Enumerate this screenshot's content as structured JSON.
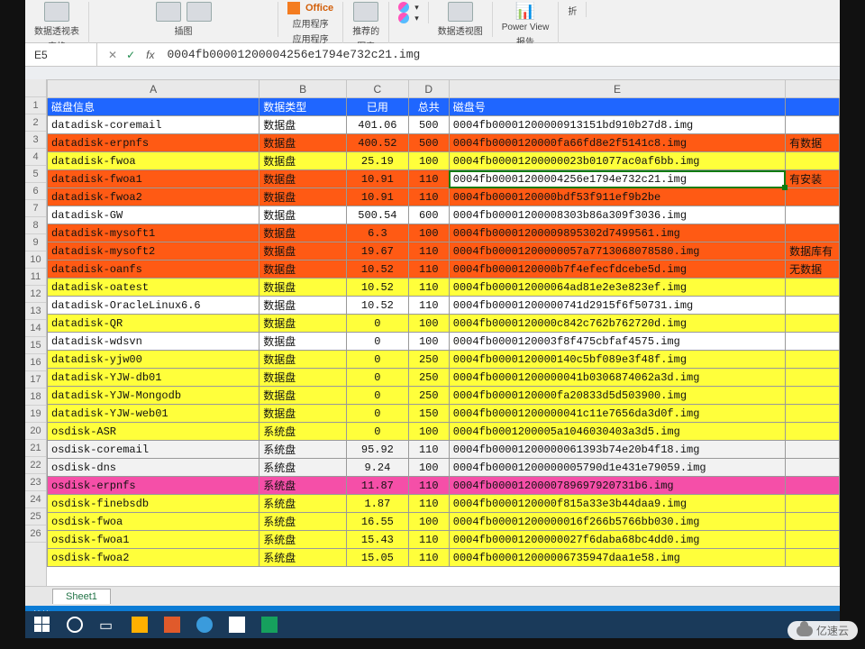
{
  "ribbon": {
    "groups": {
      "pivot": "数据透视表",
      "tables": "表格",
      "illus": "插图",
      "office_top": "Office",
      "apps1": "应用程序",
      "apps2": "应用程序",
      "reco": "推荐的",
      "charts": "图表",
      "pivotchart": "数据透视图",
      "powerview": "Power View",
      "reports": "报告",
      "fold": "折"
    }
  },
  "namebox": "E5",
  "formula": "0004fb00001200004256e1794e732c21.img",
  "columns": [
    "A",
    "B",
    "C",
    "D",
    "E"
  ],
  "header": {
    "A": "磁盘信息",
    "B": "数据类型",
    "C": "已用",
    "D": "总共",
    "E": "磁盘号"
  },
  "rows": [
    {
      "n": 2,
      "cls": "rw",
      "A": "datadisk-coremail",
      "B": "数据盘",
      "C": "401.06",
      "D": "500",
      "E": "0004fb00001200000913151bd910b27d8.img",
      "F": ""
    },
    {
      "n": 3,
      "cls": "ro",
      "A": "datadisk-erpnfs",
      "B": "数据盘",
      "C": "400.52",
      "D": "500",
      "E": "0004fb0000120000fa66fd8e2f5141c8.img",
      "F": "有数据"
    },
    {
      "n": 4,
      "cls": "ry",
      "A": "datadisk-fwoa",
      "B": "数据盘",
      "C": "25.19",
      "D": "100",
      "E": "0004fb00001200000023b01077ac0af6bb.img",
      "F": ""
    },
    {
      "n": 5,
      "cls": "ro",
      "A": "datadisk-fwoa1",
      "B": "数据盘",
      "C": "10.91",
      "D": "110",
      "E": "0004fb00001200004256e1794e732c21.img",
      "F": "有安装",
      "sel": true
    },
    {
      "n": 6,
      "cls": "ro",
      "A": "datadisk-fwoa2",
      "B": "数据盘",
      "C": "10.91",
      "D": "110",
      "E": "0004fb0000120000bdf53f911ef9b2be",
      "F": ""
    },
    {
      "n": 7,
      "cls": "rw",
      "A": "datadisk-GW",
      "B": "数据盘",
      "C": "500.54",
      "D": "600",
      "E": "0004fb00001200008303b86a309f3036.img",
      "F": ""
    },
    {
      "n": 8,
      "cls": "ro",
      "A": "datadisk-mysoft1",
      "B": "数据盘",
      "C": "6.3",
      "D": "100",
      "E": "0004fb00001200009895302d7499561.img",
      "F": ""
    },
    {
      "n": 9,
      "cls": "ro",
      "A": "datadisk-mysoft2",
      "B": "数据盘",
      "C": "19.67",
      "D": "110",
      "E": "0004fb00001200000057a7713068078580.img",
      "F": "数据库有"
    },
    {
      "n": 10,
      "cls": "ro",
      "A": "datadisk-oanfs",
      "B": "数据盘",
      "C": "10.52",
      "D": "110",
      "E": "0004fb0000120000b7f4efecfdcebe5d.img",
      "F": "无数据"
    },
    {
      "n": 11,
      "cls": "ry",
      "A": "datadisk-oatest",
      "B": "数据盘",
      "C": "10.52",
      "D": "110",
      "E": "0004fb000012000064ad81e2e3e823ef.img",
      "F": ""
    },
    {
      "n": 12,
      "cls": "rw",
      "A": "datadisk-OracleLinux6.6",
      "B": "数据盘",
      "C": "10.52",
      "D": "110",
      "E": "0004fb00001200000741d2915f6f50731.img",
      "F": ""
    },
    {
      "n": 13,
      "cls": "ry",
      "A": "datadisk-QR",
      "B": "数据盘",
      "C": "0",
      "D": "100",
      "E": "0004fb0000120000c842c762b762720d.img",
      "F": ""
    },
    {
      "n": 14,
      "cls": "rw",
      "A": "datadisk-wdsvn",
      "B": "数据盘",
      "C": "0",
      "D": "100",
      "E": "0004fb0000120003f8f475cbfaf4575.img",
      "F": ""
    },
    {
      "n": 15,
      "cls": "ry",
      "A": "datadisk-yjw00",
      "B": "数据盘",
      "C": "0",
      "D": "250",
      "E": "0004fb0000120000140c5bf089e3f48f.img",
      "F": ""
    },
    {
      "n": 16,
      "cls": "ry",
      "A": "datadisk-YJW-db01",
      "B": "数据盘",
      "C": "0",
      "D": "250",
      "E": "0004fb00001200000041b0306874062a3d.img",
      "F": ""
    },
    {
      "n": 17,
      "cls": "ry",
      "A": "datadisk-YJW-Mongodb",
      "B": "数据盘",
      "C": "0",
      "D": "250",
      "E": "0004fb0000120000fa20833d5d503900.img",
      "F": ""
    },
    {
      "n": 18,
      "cls": "ry",
      "A": "datadisk-YJW-web01",
      "B": "数据盘",
      "C": "0",
      "D": "150",
      "E": "0004fb00001200000041c11e7656da3d0f.img",
      "F": ""
    },
    {
      "n": 19,
      "cls": "ry",
      "A": "osdisk-ASR",
      "B": "系统盘",
      "C": "0",
      "D": "100",
      "E": "0004fb0001200005a1046030403a3d5.img",
      "F": ""
    },
    {
      "n": 20,
      "cls": "rw2",
      "A": "osdisk-coremail",
      "B": "系统盘",
      "C": "95.92",
      "D": "110",
      "E": "0004fb00001200000061393b74e20b4f18.img",
      "F": ""
    },
    {
      "n": 21,
      "cls": "rw2",
      "A": "osdisk-dns",
      "B": "系统盘",
      "C": "9.24",
      "D": "100",
      "E": "0004fb00001200000005790d1e431e79059.img",
      "F": ""
    },
    {
      "n": 22,
      "cls": "rp",
      "A": "osdisk-erpnfs",
      "B": "系统盘",
      "C": "11.87",
      "D": "110",
      "E": "0004fb0000120000789697920731b6.img",
      "F": ""
    },
    {
      "n": 23,
      "cls": "ry",
      "A": "osdisk-finebsdb",
      "B": "系统盘",
      "C": "1.87",
      "D": "110",
      "E": "0004fb0000120000f815a33e3b44daa9.img",
      "F": ""
    },
    {
      "n": 24,
      "cls": "ry",
      "A": "osdisk-fwoa",
      "B": "系统盘",
      "C": "16.55",
      "D": "100",
      "E": "0004fb00001200000016f266b5766bb030.img",
      "F": ""
    },
    {
      "n": 25,
      "cls": "ry",
      "A": "osdisk-fwoa1",
      "B": "系统盘",
      "C": "15.43",
      "D": "110",
      "E": "0004fb00001200000027f6daba68bc4dd0.img",
      "F": ""
    },
    {
      "n": 26,
      "cls": "ry",
      "A": "osdisk-fwoa2",
      "B": "系统盘",
      "C": "15.05",
      "D": "110",
      "E": "0004fb000012000006735947daa1e58.img",
      "F": ""
    }
  ],
  "sheet_tab": "Sheet1",
  "status": "就绪",
  "watermark": "亿速云"
}
